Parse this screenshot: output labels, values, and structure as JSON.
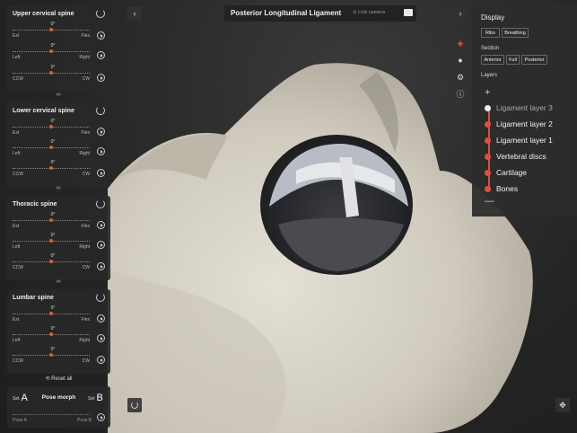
{
  "header": {
    "title": "Posterior Longitudinal Ligament",
    "link_camera": "Link camera",
    "back_label": "‹",
    "forward_label": "›"
  },
  "sections": [
    {
      "title": "Upper cervical spine",
      "sliders": [
        {
          "value": "0°",
          "left": "Ext",
          "right": "Flex"
        },
        {
          "value": "0°",
          "left": "Left",
          "right": "Right"
        },
        {
          "value": "0°",
          "left": "CCW",
          "right": "CW"
        }
      ]
    },
    {
      "title": "Lower cervical spine",
      "sliders": [
        {
          "value": "0°",
          "left": "Ext",
          "right": "Flex"
        },
        {
          "value": "0°",
          "left": "Left",
          "right": "Right"
        },
        {
          "value": "0°",
          "left": "CCW",
          "right": "CW"
        }
      ]
    },
    {
      "title": "Thoracic spine",
      "sliders": [
        {
          "value": "0°",
          "left": "Ext",
          "right": "Flex"
        },
        {
          "value": "0°",
          "left": "Left",
          "right": "Right"
        },
        {
          "value": "0°",
          "left": "CCW",
          "right": "CW"
        }
      ]
    },
    {
      "title": "Lumbar spine",
      "sliders": [
        {
          "value": "0°",
          "left": "Ext",
          "right": "Flex"
        },
        {
          "value": "0°",
          "left": "Left",
          "right": "Right"
        },
        {
          "value": "0°",
          "left": "CCW",
          "right": "CW"
        }
      ]
    }
  ],
  "reset_all": "Reset all",
  "pose": {
    "set_label": "Set",
    "a": "A",
    "b": "B",
    "title": "Pose morph",
    "pose_a": "Pose A",
    "pose_b": "Pose B"
  },
  "display": {
    "title": "Display",
    "toggles": [
      "Ribs",
      "Breathing"
    ],
    "section_label": "Section",
    "section_options": [
      "Anterior",
      "Full",
      "Posterior"
    ],
    "layers_label": "Layers",
    "layers": [
      "Ligament layer 3",
      "Ligament layer 2",
      "Ligament layer 1",
      "Vertebral discs",
      "Cartilage",
      "Bones"
    ],
    "selected_layer": "Ligament layer 3",
    "plus": "+",
    "minus": "—"
  },
  "colors": {
    "accent": "#d9533a",
    "bone": "#d8d3c8",
    "panel": "#2c2c2c"
  }
}
